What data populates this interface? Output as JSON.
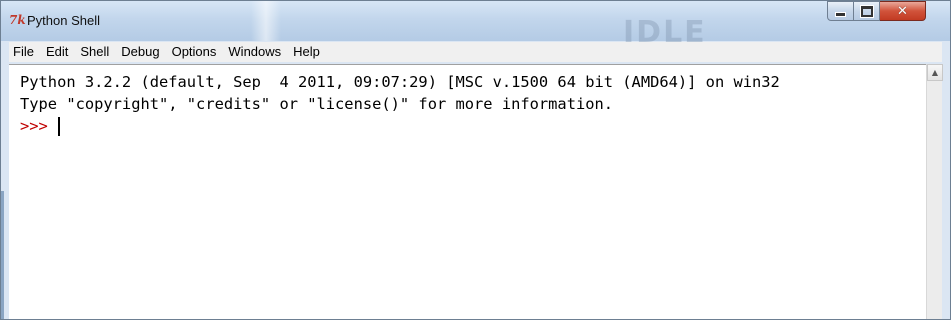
{
  "window": {
    "title": "Python Shell",
    "icon": "tk-feather-icon",
    "watermark": "IDLE"
  },
  "caption_buttons": {
    "minimize": "minimize-icon",
    "maximize": "maximize-icon",
    "close": "close-icon"
  },
  "menu": {
    "items": [
      {
        "label": "File"
      },
      {
        "label": "Edit"
      },
      {
        "label": "Shell"
      },
      {
        "label": "Debug"
      },
      {
        "label": "Options"
      },
      {
        "label": "Windows"
      },
      {
        "label": "Help"
      }
    ]
  },
  "shell": {
    "lines": [
      "Python 3.2.2 (default, Sep  4 2011, 09:07:29) [MSC v.1500 64 bit (AMD64)] on win32",
      "Type \"copyright\", \"credits\" or \"license()\" for more information."
    ],
    "prompt": ">>>"
  },
  "colors": {
    "prompt": "#c00000",
    "close_button": "#c23b23",
    "titlebar": "#c2d6ec"
  }
}
